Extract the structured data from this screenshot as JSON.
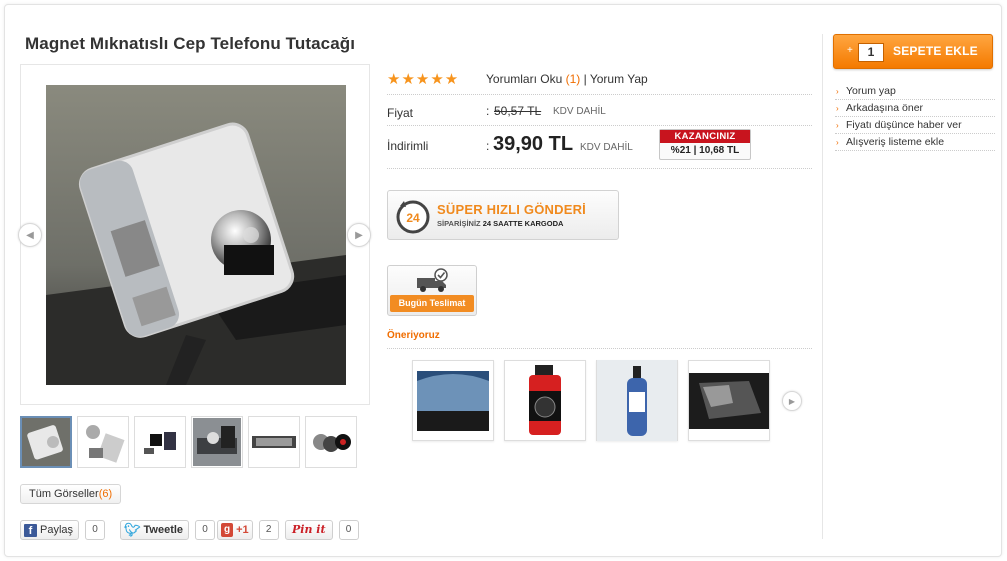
{
  "product": {
    "title": "Magnet Mıknatıslı Cep Telefonu Tutacağı",
    "rating_stars": "★★★★★",
    "reviews_read": "Yorumları Oku",
    "reviews_count": "(1)",
    "review_write": "| Yorum Yap",
    "price_label": "Fiyat",
    "old_price": "50,57 TL",
    "kdv": "KDV DAHİL",
    "discount_label": "İndirimli",
    "new_price": "39,90 TL",
    "colon": ":",
    "savings_title": "KAZANCINIZ",
    "savings_value": "%21  |  10,68 TL"
  },
  "gallery": {
    "all_images_label": "Tüm Görseller",
    "all_images_count": "(6)",
    "thumbnails": [
      "thumb-1",
      "thumb-2",
      "thumb-3",
      "thumb-4",
      "thumb-5",
      "thumb-6"
    ]
  },
  "social": {
    "facebook_label": "Paylaş",
    "facebook_count": "0",
    "twitter_label": "Tweetle",
    "twitter_count": "0",
    "gplus_label": "+1",
    "gplus_count": "2",
    "pinterest_label": "Pin it",
    "pinterest_count": "0"
  },
  "shipping": {
    "fast_title": "SÜPER HIZLI GÖNDERİ",
    "fast_sub_prefix": "SİPARİŞİNİZ ",
    "fast_sub_bold": "24 SAATTE KARGODA",
    "fast_badge": "24",
    "today_label": "Bugün Teslimat"
  },
  "recommend": {
    "title": "Öneriyoruz"
  },
  "cart": {
    "plus": "+",
    "quantity": "1",
    "add_label": "SEPETE EKLE"
  },
  "side_links": [
    "Yorum yap",
    "Arkadaşına öner",
    "Fiyatı düşünce haber ver",
    "Alışveriş listeme ekle"
  ],
  "colors": {
    "accent": "#f06d00",
    "star": "#f7941d",
    "savings_red": "#c8141e"
  }
}
